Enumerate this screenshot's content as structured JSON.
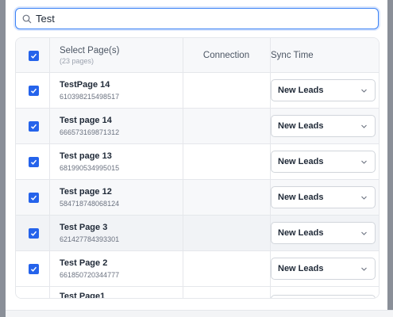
{
  "search": {
    "value": "Test"
  },
  "table": {
    "columns": {
      "select_title": "Select Page(s)",
      "select_count": "(23 pages)",
      "connection": "Connection",
      "sync_time": "Sync Time"
    },
    "header_checked": true,
    "rows": [
      {
        "name": "TestPage 14",
        "id": "610398215498517",
        "checked": true,
        "sync": "New Leads"
      },
      {
        "name": "Test page 14",
        "id": "666573169871312",
        "checked": true,
        "sync": "New Leads"
      },
      {
        "name": "Test page 13",
        "id": "681990534995015",
        "checked": true,
        "sync": "New Leads"
      },
      {
        "name": "Test page 12",
        "id": "584718748068124",
        "checked": true,
        "sync": "New Leads"
      },
      {
        "name": "Test Page 3",
        "id": "621427784393301",
        "checked": true,
        "sync": "New Leads"
      },
      {
        "name": "Test Page 2",
        "id": "661850720344777",
        "checked": true,
        "sync": "New Leads"
      },
      {
        "name": "Test Page1",
        "id": "",
        "checked": false,
        "sync": ""
      }
    ]
  },
  "colors": {
    "accent": "#2563eb",
    "focus_ring": "#3b82f6"
  }
}
